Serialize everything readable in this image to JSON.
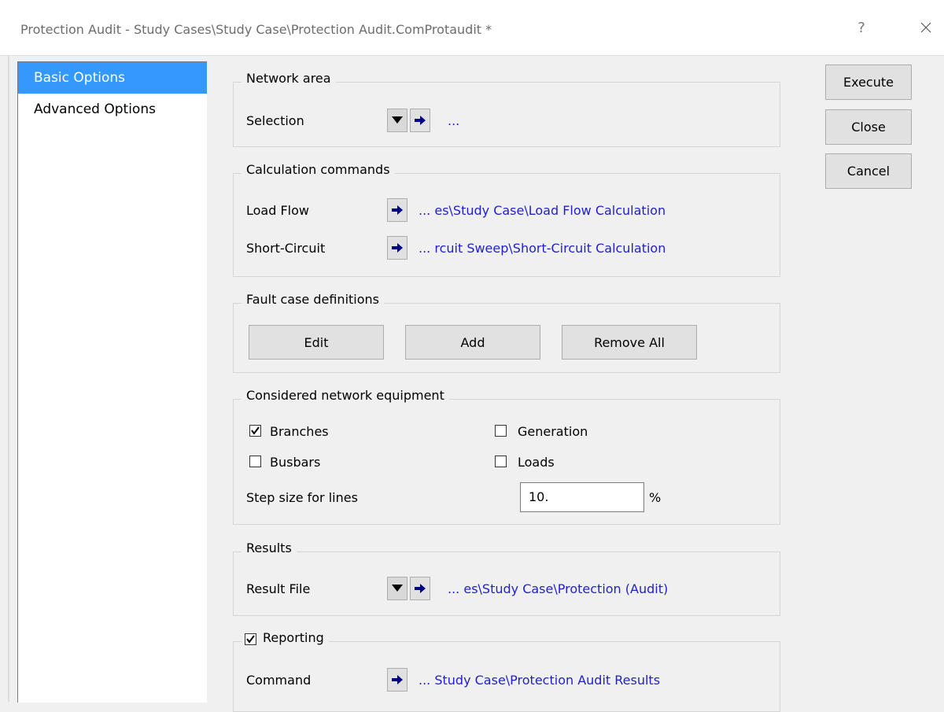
{
  "window": {
    "title": "Protection Audit - Study Cases\\Study Case\\Protection Audit.ComProtaudit *",
    "help_label": "?"
  },
  "nav": {
    "items": [
      {
        "label": "Basic Options",
        "active": true
      },
      {
        "label": "Advanced Options",
        "active": false
      }
    ]
  },
  "actions": {
    "execute": "Execute",
    "close": "Close",
    "cancel": "Cancel"
  },
  "network_area": {
    "title": "Network area",
    "selection_label": "Selection",
    "selection_value": "..."
  },
  "calc_commands": {
    "title": "Calculation commands",
    "load_flow_label": "Load Flow",
    "load_flow_value": "... es\\Study Case\\Load Flow Calculation",
    "short_circuit_label": "Short-Circuit",
    "short_circuit_value": "... rcuit Sweep\\Short-Circuit Calculation"
  },
  "fault_cases": {
    "title": "Fault case definitions",
    "edit": "Edit",
    "add": "Add",
    "remove_all": "Remove All"
  },
  "equipment": {
    "title": "Considered network equipment",
    "branches": {
      "label": "Branches",
      "checked": true
    },
    "busbars": {
      "label": "Busbars",
      "checked": false
    },
    "generation": {
      "label": "Generation",
      "checked": false
    },
    "loads": {
      "label": "Loads",
      "checked": false
    },
    "step_size_label": "Step size for lines",
    "step_size_value": "10.",
    "step_size_unit": "%"
  },
  "results": {
    "title": "Results",
    "file_label": "Result File",
    "file_value": "... es\\Study Case\\Protection (Audit)"
  },
  "reporting": {
    "title": "Reporting",
    "checked": true,
    "command_label": "Command",
    "command_value": "... Study Case\\Protection Audit Results"
  },
  "colors": {
    "accent": "#3399ff",
    "link": "#1f1fcf",
    "arrow": "#000080"
  }
}
